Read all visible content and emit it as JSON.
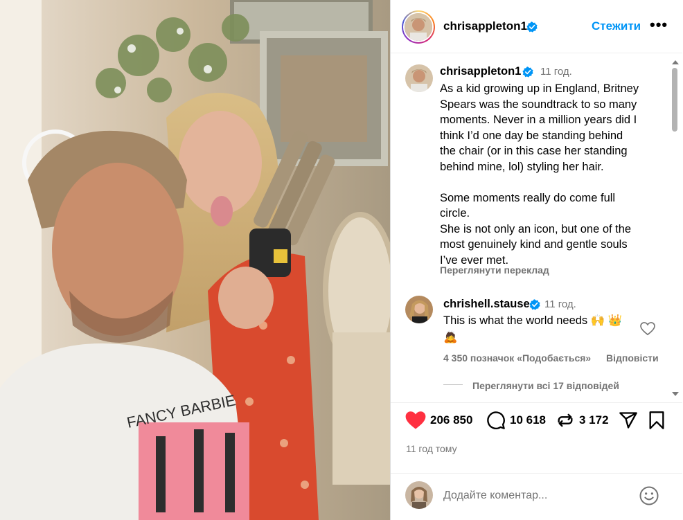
{
  "post": {
    "username": "chrisappleton1",
    "follow_label": "Стежити",
    "more_label": "•••"
  },
  "caption": {
    "username": "chrisappleton1",
    "time": "11 год.",
    "text": "As a kid growing up in England, Britney\nSpears was the soundtrack to so many\nmoments. Never in a million years did I\nthink I’d one day be standing behind\nthe chair (or in this case her standing\nbehind mine, lol) styling her hair.\n\nSome moments really do come full\ncircle.\nShe is not only an icon, but one of the\nmost genuinely kind and gentle souls\nI’ve ever met.",
    "see_translation": "Переглянути переклад"
  },
  "comment": {
    "username": "chrishell.stause",
    "time": "11 год.",
    "text": "This is what the world needs",
    "emojis": [
      "🙌",
      "👑",
      "🙇"
    ],
    "likes": "4 350 позначок «Подобається»",
    "reply": "Відповісти",
    "view_replies": "Переглянути всі 17 відповідей"
  },
  "actions": {
    "likes_count": "206 850",
    "comments_count": "10 618",
    "reposts_count": "3 172",
    "like_icon": "heart-filled-icon",
    "comment_icon": "speech-bubble-icon",
    "repost_icon": "repost-icon",
    "share_icon": "paper-plane-icon",
    "save_icon": "bookmark-icon",
    "like_color": "#ff3040"
  },
  "time_ago": "11 год тому",
  "comment_box": {
    "placeholder": "Додайте коментар..."
  },
  "colors": {
    "accent": "#0095f6",
    "verified": "#0095f6",
    "muted": "#737373"
  }
}
